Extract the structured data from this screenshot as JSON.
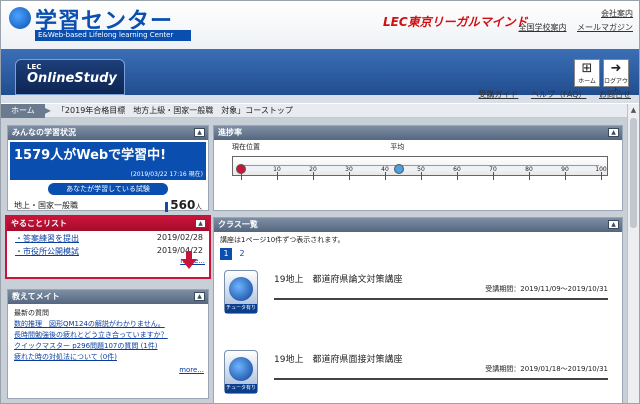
{
  "header": {
    "logo_title": "学習センター",
    "logo_subtitle": "E&Web-based Lifelong learning Center",
    "lec_logo": "LEC東京リーガルマインド",
    "links_row1": [
      "会社案内"
    ],
    "links_row2": [
      "全国学校案内",
      "メールマガジン"
    ]
  },
  "nav": {
    "brand_small": "LEC",
    "brand": "OnlineStudy",
    "home_label": "ホーム",
    "logout_label": "ログアウト",
    "help_links": [
      "受講ガイド",
      "ヘルプ（FAQ）",
      "お問合せ"
    ]
  },
  "breadcrumb": {
    "home": "ホーム",
    "current": "「2019年合格目標　地方上級・国家一般職　対象」コーストップ"
  },
  "status_panel": {
    "title": "みんなの学習状況",
    "learning_count": "1579",
    "learning_suffix": "人がWebで学習中!",
    "as_of": "(2019/03/22 17:16 現在)",
    "your_test_label": "あなたが学習している試験",
    "course_name": "地上・国家一般職",
    "course_count": "560",
    "course_unit": "人"
  },
  "todo_panel": {
    "title": "やることリスト",
    "items": [
      {
        "label": "・答案練習を提出",
        "date": "2019/02/28"
      },
      {
        "label": "・市役所公開模試",
        "date": "2019/04/22"
      }
    ],
    "more": "more..."
  },
  "qa_panel": {
    "title": "教えてメイト",
    "recent_label": "最新の質問",
    "items": [
      "数的推理　図形QM124の解説がわかりません。",
      "長時間勉強後の疲れとどう立き合っていますか？",
      "クイックマスター p296問題107の質問 (1件)",
      "疲れた時の対処法について (0件)"
    ],
    "more": "more..."
  },
  "progress_panel": {
    "title": "進捗率",
    "current_label": "現在位置",
    "average_label": "平均",
    "ticks": [
      "0",
      "10",
      "20",
      "30",
      "40",
      "50",
      "60",
      "70",
      "80",
      "90",
      "100"
    ],
    "current_value": 0,
    "average_value": 44
  },
  "class_panel": {
    "title": "クラス一覧",
    "info": "講座は1ページ10件ずつ表示されます。",
    "pages": [
      "1",
      "2"
    ],
    "icon_tag": "チュータ有り",
    "items": [
      {
        "title": "19地上　都道府県論文対策講座",
        "period": "受講期間：2019/11/09〜2019/10/31"
      },
      {
        "title": "19地上　都道府県面接対策講座",
        "period": "受講期間：2019/01/18〜2019/10/31"
      }
    ]
  },
  "colors": {
    "brand_blue": "#0a4fb0",
    "alert_red": "#c9143a",
    "panel_header": "#55677f"
  }
}
